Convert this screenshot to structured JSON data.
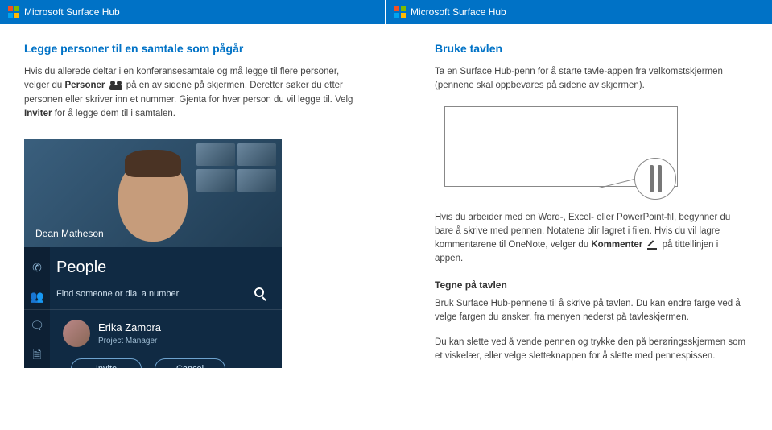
{
  "brand": {
    "label": "Microsoft Surface Hub"
  },
  "left": {
    "title": "Legge personer til en samtale som pågår",
    "p1a": "Hvis du allerede deltar i en konferansesamtale og må legge til flere personer, velger du ",
    "p1b_strong": "Personer",
    "p1c": " på en av sidene på skjermen. Deretter søker du etter personen eller skriver inn et nummer. Gjenta for hver person du vil legge til. Velg ",
    "p1d_strong": "Inviter",
    "p1e": " for å legge dem til i samtalen."
  },
  "panel": {
    "caller": "Dean Matheson",
    "people_title": "People",
    "search_placeholder": "Find someone or dial a number",
    "contact_name": "Erika Zamora",
    "contact_role": "Project Manager",
    "invite": "Invite",
    "cancel": "Cancel"
  },
  "right": {
    "title": "Bruke tavlen",
    "p1": "Ta en Surface Hub-penn for å starte tavle-appen fra velkomstskjermen (pennene skal oppbevares på sidene av skjermen).",
    "p2a": "Hvis du arbeider med en Word-, Excel- eller PowerPoint-fil, begynner du bare å skrive med pennen. Notatene blir lagret i filen. Hvis du vil lagre kommentarene til OneNote, velger du ",
    "p2b_strong": "Kommenter",
    "p2c": " på tittellinjen i appen.",
    "sub": "Tegne på tavlen",
    "p3": "Bruk Surface Hub-pennene til å skrive på tavlen. Du kan endre farge ved å velge fargen du ønsker, fra menyen nederst på tavleskjermen.",
    "p4": "Du kan slette ved å vende pennen og trykke den på berøringsskjermen som et viskelær, eller velge sletteknappen for å slette med pennespissen."
  }
}
